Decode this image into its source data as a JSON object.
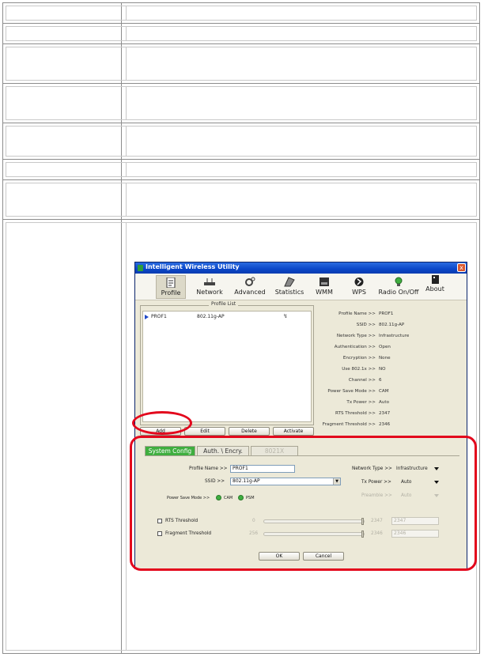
{
  "window": {
    "title": "Intelligent Wireless Utility",
    "close_glyph": "x"
  },
  "toolbar": [
    {
      "label": "Profile",
      "icon": "profile-icon"
    },
    {
      "label": "Network",
      "icon": "network-icon"
    },
    {
      "label": "Advanced",
      "icon": "advanced-icon"
    },
    {
      "label": "Statistics",
      "icon": "statistics-icon"
    },
    {
      "label": "WMM",
      "icon": "wmm-icon"
    },
    {
      "label": "WPS",
      "icon": "wps-icon"
    },
    {
      "label": "Radio On/Off",
      "icon": "radio-icon"
    },
    {
      "label": "About",
      "icon": "about-icon"
    }
  ],
  "profile_list": {
    "title": "Profile List",
    "rows": [
      {
        "name": "PROF1",
        "ssid": "802.11g-AP"
      }
    ],
    "buttons": {
      "add": "Add",
      "edit": "Edit",
      "delete": "Delete",
      "activate": "Activate"
    }
  },
  "profile_detail": [
    {
      "key": "Profile Name >>",
      "value": "PROF1"
    },
    {
      "key": "SSID >>",
      "value": "802.11g-AP"
    },
    {
      "key": "Network Type >>",
      "value": "Infrastructure"
    },
    {
      "key": "Authentication >>",
      "value": "Open"
    },
    {
      "key": "Encryption >>",
      "value": "None"
    },
    {
      "key": "Use 802.1x >>",
      "value": "NO"
    },
    {
      "key": "Channel >>",
      "value": "6"
    },
    {
      "key": "Power Save Mode >>",
      "value": "CAM"
    },
    {
      "key": "Tx Power >>",
      "value": "Auto"
    },
    {
      "key": "RTS Threshold >>",
      "value": "2347"
    },
    {
      "key": "Fragment Threshold >>",
      "value": "2346"
    }
  ],
  "config": {
    "tabs": {
      "system": "System Config",
      "auth": "Auth. \\ Encry.",
      "x8021": "8021X"
    },
    "profile_name_label": "Profile Name >>",
    "profile_name_value": "PROF1",
    "ssid_label": "SSID >>",
    "ssid_value": "802.11g-AP",
    "power_save_label": "Power Save Mode >>",
    "power_cam": "CAM",
    "power_psm": "PSM",
    "network_type_label": "Network Type >>",
    "network_type_value": "Infrastructure",
    "tx_power_label": "Tx Power >>",
    "tx_power_value": "Auto",
    "preamble_label": "Preamble >>",
    "preamble_value": "Auto",
    "rts_label": "RTS Threshold",
    "rts_min": "0",
    "rts_max": "2347",
    "rts_value": "2347",
    "frag_label": "Fragment Threshold",
    "frag_min": "256",
    "frag_max": "2346",
    "frag_value": "2346",
    "ok": "OK",
    "cancel": "Cancel"
  },
  "colors": {
    "highlight": "#e3061c",
    "active_tab": "#3fae3f",
    "titlebar": "#0a46c8"
  }
}
